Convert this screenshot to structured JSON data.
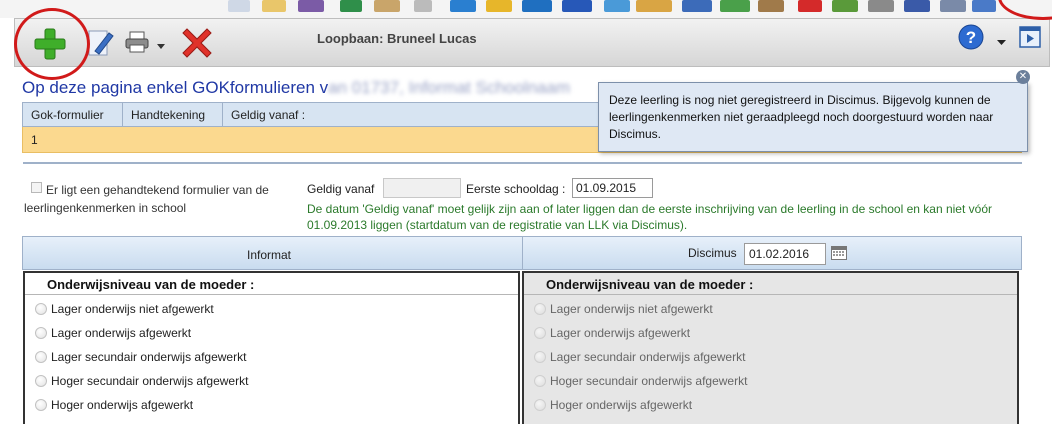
{
  "toolbar": {
    "title": "Loopbaan: Bruneel Lucas",
    "add_icon": "plus-icon",
    "edit_icon": "pencil-icon",
    "print_icon": "printer-icon",
    "cancel_icon": "red-x-icon",
    "help_icon": "help-icon",
    "more_icon": "chevron-down-icon",
    "media_icon": "play-window-icon"
  },
  "heading": {
    "text": "Op deze pagina enkel GOKformulieren v",
    "obscured": "an 01737, Informat Schoolnaam"
  },
  "gok_table": {
    "headers": [
      "Gok-formulier",
      "Handtekening",
      "Geldig vanaf :"
    ],
    "rows": [
      [
        "1",
        "",
        ""
      ]
    ]
  },
  "tooltip": {
    "text": "Deze leerling is nog niet geregistreerd in Discimus. Bijgevolg kunnen de leerlingenkenmerken niet geraadpleegd noch doorgestuurd worden naar Discimus."
  },
  "form": {
    "signed_label": "Er ligt een gehandtekend formulier van de leerlingenkenmerken in school",
    "signed_checked": false,
    "geldig_label": "Geldig vanaf",
    "geldig_value": "",
    "eerste_label": "Eerste schooldag :",
    "eerste_value": "01.09.2015",
    "note": "De datum 'Geldig vanaf' moet gelijk zijn aan of later liggen dan de eerste inschrijving van de leerling in de school en kan niet vóór 01.09.2013 liggen (startdatum van de registratie van LLK via Discimus)."
  },
  "compare": {
    "informat_label": "Informat",
    "discimus_label": "Discimus",
    "discimus_date": "01.02.2016"
  },
  "panel_left": {
    "title": "Onderwijsniveau van de moeder :",
    "options": [
      "Lager onderwijs niet afgewerkt",
      "Lager onderwijs afgewerkt",
      "Lager secundair onderwijs afgewerkt",
      "Hoger secundair onderwijs afgewerkt",
      "Hoger onderwijs afgewerkt"
    ]
  },
  "panel_right": {
    "title": "Onderwijsniveau van de moeder :",
    "options": [
      "Lager onderwijs niet afgewerkt",
      "Lager onderwijs afgewerkt",
      "Lager secundair onderwijs afgewerkt",
      "Hoger secundair onderwijs afgewerkt",
      "Hoger onderwijs afgewerkt"
    ]
  },
  "colors": {
    "heading_blue": "#2038a5",
    "row_highlight": "#fbd98f",
    "note_green": "#2b7a2b",
    "annotation_red": "#d11a1a"
  }
}
